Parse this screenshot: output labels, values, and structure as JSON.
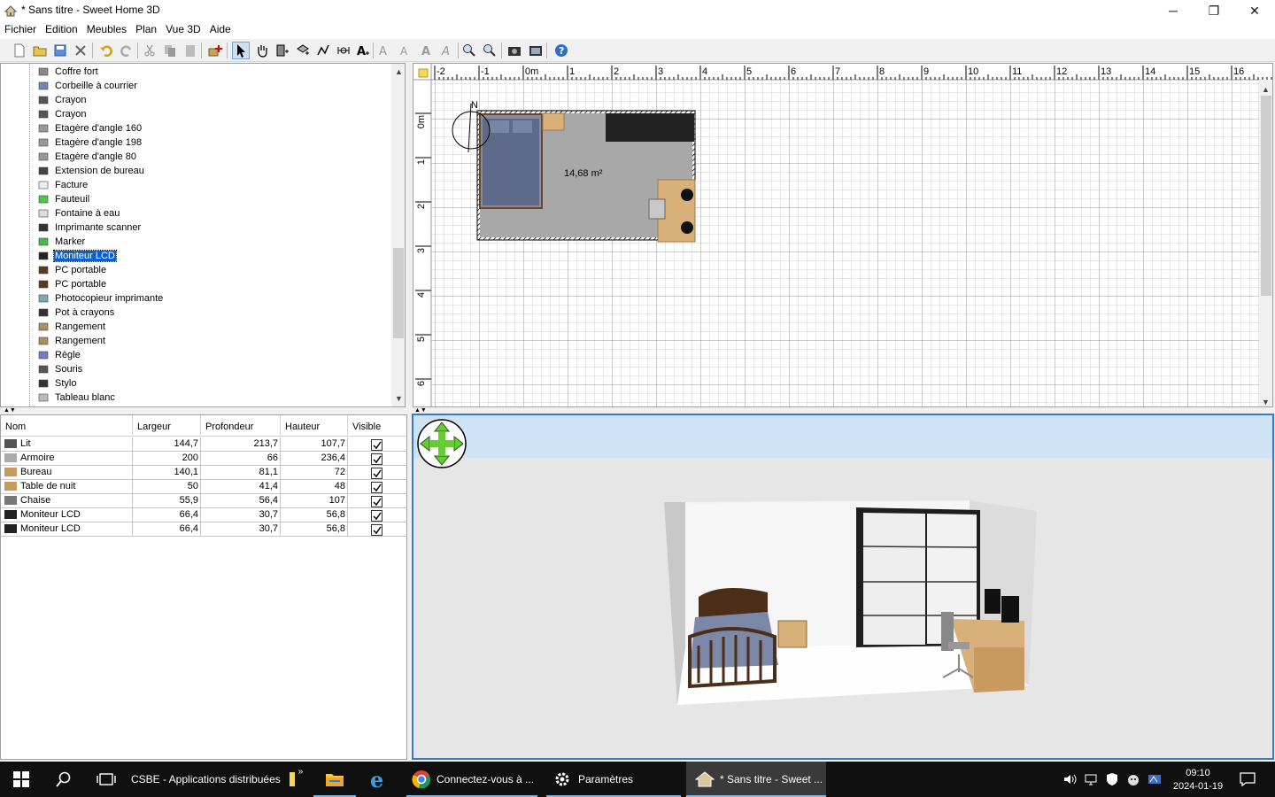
{
  "window": {
    "title": "* Sans titre - Sweet Home 3D",
    "minimize": "─",
    "maximize": "❐",
    "close": "✕"
  },
  "menu": [
    "Fichier",
    "Edition",
    "Meubles",
    "Plan",
    "Vue 3D",
    "Aide"
  ],
  "toolbar": {
    "buttons": [
      "new-file-icon",
      "open-file-icon",
      "save-file-icon",
      "preferences-icon",
      "undo-icon",
      "redo-icon",
      "cut-icon",
      "copy-icon",
      "paste-icon",
      "add-furniture-icon",
      "select-mode-icon",
      "pan-mode-icon",
      "create-walls-icon",
      "create-rooms-icon",
      "create-polylines-icon",
      "create-dimensions-icon",
      "add-text-icon",
      "increase-text-icon",
      "decrease-text-icon",
      "bold-text-icon",
      "italic-text-icon",
      "zoom-in-icon",
      "zoom-out-icon",
      "create-photo-icon",
      "create-video-icon",
      "help-icon"
    ]
  },
  "catalog": {
    "items": [
      {
        "label": "Coffre fort",
        "icon": "safe-icon"
      },
      {
        "label": "Corbeille à courrier",
        "icon": "mail-tray-icon"
      },
      {
        "label": "Crayon",
        "icon": "pencil-icon"
      },
      {
        "label": "Crayon",
        "icon": "pencil-icon"
      },
      {
        "label": "Etagère d'angle 160",
        "icon": "corner-shelf-icon"
      },
      {
        "label": "Etagère d'angle 198",
        "icon": "corner-shelf-icon"
      },
      {
        "label": "Etagère d'angle 80",
        "icon": "corner-shelf-icon"
      },
      {
        "label": "Extension de bureau",
        "icon": "desk-extension-icon"
      },
      {
        "label": "Facture",
        "icon": "invoice-icon"
      },
      {
        "label": "Fauteuil",
        "icon": "armchair-icon"
      },
      {
        "label": "Fontaine à eau",
        "icon": "water-fountain-icon"
      },
      {
        "label": "Imprimante scanner",
        "icon": "printer-icon"
      },
      {
        "label": "Marker",
        "icon": "marker-icon"
      },
      {
        "label": "Moniteur LCD",
        "icon": "monitor-icon",
        "selected": true
      },
      {
        "label": "PC portable",
        "icon": "laptop-icon"
      },
      {
        "label": "PC portable",
        "icon": "laptop-icon"
      },
      {
        "label": "Photocopieur imprimante",
        "icon": "photocopier-icon"
      },
      {
        "label": "Pot à crayons",
        "icon": "pencil-cup-icon"
      },
      {
        "label": "Rangement",
        "icon": "storage-icon"
      },
      {
        "label": "Rangement",
        "icon": "storage-icon"
      },
      {
        "label": "Règle",
        "icon": "ruler-icon"
      },
      {
        "label": "Souris",
        "icon": "mouse-icon"
      },
      {
        "label": "Stylo",
        "icon": "pen-icon"
      },
      {
        "label": "Tableau blanc",
        "icon": "whiteboard-icon"
      }
    ]
  },
  "furniture_table": {
    "headers": [
      "Nom",
      "Largeur",
      "Profondeur",
      "Hauteur",
      "Visible"
    ],
    "rows": [
      {
        "name": "Lit",
        "width": "144,7",
        "depth": "213,7",
        "height": "107,7",
        "visible": true,
        "icon": "bed-icon"
      },
      {
        "name": "Armoire",
        "width": "200",
        "depth": "66",
        "height": "236,4",
        "visible": true,
        "icon": "wardrobe-icon"
      },
      {
        "name": "Bureau",
        "width": "140,1",
        "depth": "81,1",
        "height": "72",
        "visible": true,
        "icon": "desk-icon"
      },
      {
        "name": "Table de nuit",
        "width": "50",
        "depth": "41,4",
        "height": "48",
        "visible": true,
        "icon": "nightstand-icon"
      },
      {
        "name": "Chaise",
        "width": "55,9",
        "depth": "56,4",
        "height": "107",
        "visible": true,
        "icon": "chair-icon"
      },
      {
        "name": "Moniteur LCD",
        "width": "66,4",
        "depth": "30,7",
        "height": "56,8",
        "visible": true,
        "icon": "monitor-icon"
      },
      {
        "name": "Moniteur LCD",
        "width": "66,4",
        "depth": "30,7",
        "height": "56,8",
        "visible": true,
        "icon": "monitor-icon"
      }
    ]
  },
  "plan": {
    "ruler_x": [
      "-2",
      "-1",
      "0m",
      "1",
      "2",
      "3",
      "4",
      "5",
      "6",
      "7",
      "8",
      "9",
      "10",
      "11",
      "12",
      "13",
      "14",
      "15",
      "16"
    ],
    "ruler_y": [
      "0m",
      "1",
      "2",
      "3",
      "4",
      "5",
      "6"
    ],
    "room_area": "14,68 m²",
    "compass": "N"
  },
  "taskbar": {
    "tasks": [
      {
        "label": "CSBE - Applications distribuées",
        "icon": "folder-icon"
      },
      {
        "label": "Connectez-vous à ...",
        "icon": "chrome-icon"
      },
      {
        "label": "Paramètres",
        "icon": "settings-icon"
      },
      {
        "label": "* Sans titre - Sweet ...",
        "icon": "sweethome-icon"
      }
    ],
    "time": "09:10",
    "date": "2024-01-19"
  },
  "colors": {
    "selection": "#0a60d0",
    "view_border": "#3a78c8",
    "sky": "#cfe3f7",
    "taskbar": "#101010"
  }
}
